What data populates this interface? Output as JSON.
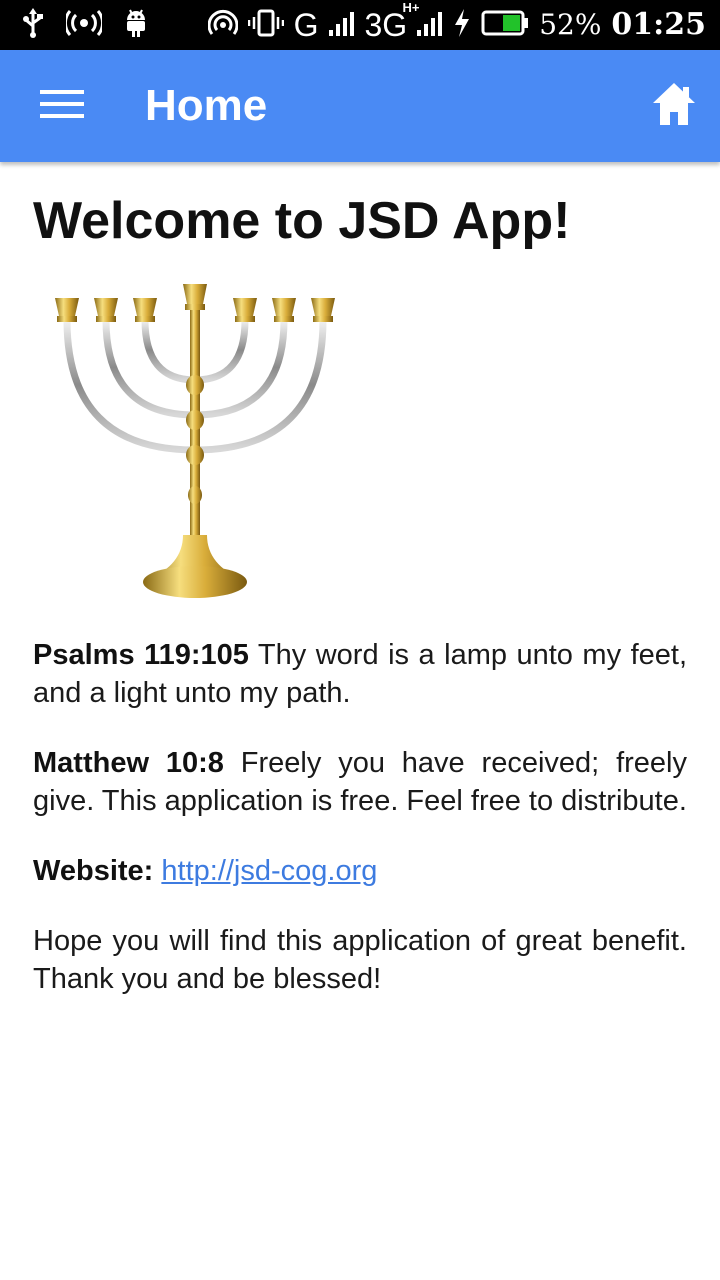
{
  "status_bar": {
    "network": "G",
    "network2": "3G",
    "network2_sup": "H+",
    "battery_percent": "52%",
    "time": "01:25"
  },
  "app_bar": {
    "title": "Home",
    "menu_icon": "hamburger-menu-icon",
    "home_icon": "home-icon",
    "color": "#4a8af4"
  },
  "content": {
    "welcome": "Welcome to JSD App!",
    "image": "menorah",
    "psalms_ref": "Psalms 119:105",
    "psalms_text": " Thy word is a lamp unto my feet, and a light unto my path.",
    "matthew_ref": "Matthew 10:8",
    "matthew_text": " Freely you have received; freely give. This application is free. Feel free to distribute.",
    "website_label": "Website:",
    "website_url": "http://jsd-cog.org",
    "closing": "Hope you will find this application of great benefit. Thank you and be blessed!",
    "link_color": "#3d7be0"
  }
}
